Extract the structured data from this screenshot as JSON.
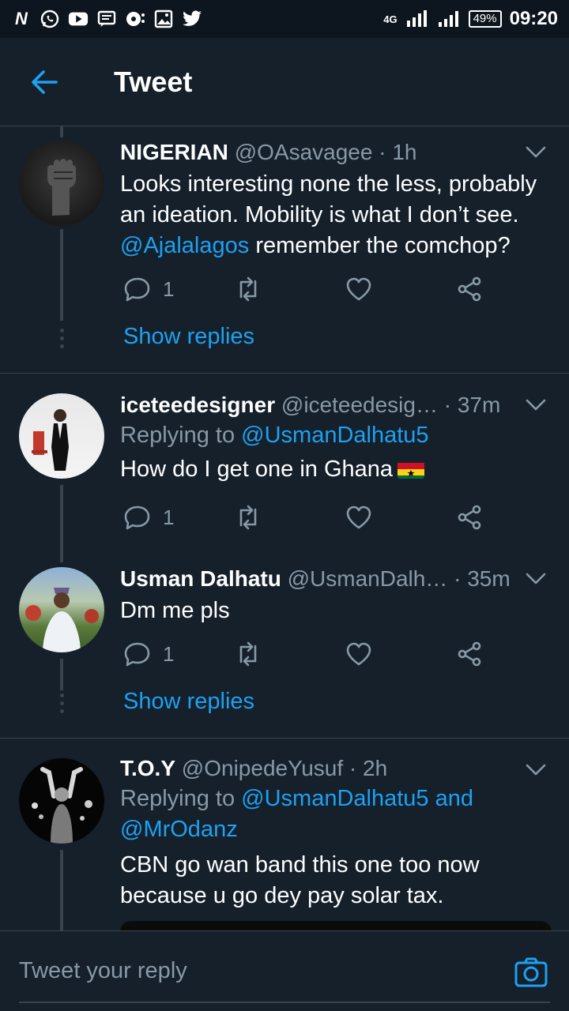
{
  "status_bar": {
    "left_icons": [
      "n-app-icon",
      "whatsapp-icon",
      "youtube-icon",
      "message-icon",
      "tv-icon",
      "gallery-icon",
      "twitter-icon"
    ],
    "network": "4G",
    "battery": "49%",
    "time": "09:20"
  },
  "header": {
    "title": "Tweet"
  },
  "tweets": [
    {
      "name": "NIGERIAN",
      "handle": "@OAsavagee",
      "time": "· 1h",
      "text": "Looks interesting none the less, probably an ideation. Mobility is what I don’t see.",
      "mention": "@Ajalalagos",
      "text_after": " remember the comchop?",
      "replies": "1",
      "show_replies": "Show replies"
    },
    {
      "name": "iceteedesigner",
      "handle": "@iceteedesig…",
      "time": "· 37m",
      "replying_prefix": "Replying to ",
      "replying_to": "@UsmanDalhatu5",
      "text": "How do I get one in Ghana",
      "replies": "1"
    },
    {
      "name": "Usman Dalhatu",
      "handle": "@UsmanDalh…",
      "time": "· 35m",
      "text": "Dm me pls",
      "replies": "1",
      "show_replies": "Show replies"
    },
    {
      "name": "T.O.Y",
      "handle": "@OnipedeYusuf",
      "time": "· 2h",
      "replying_prefix": "Replying to ",
      "replying_to": "@UsmanDalhatu5 and @MrOdanz",
      "text": "CBN go wan band this one too now because u go dey pay solar tax."
    }
  ],
  "composer": {
    "placeholder": "Tweet your reply"
  },
  "colors": {
    "background": "#15202b",
    "accent": "#1da1f2",
    "muted": "#8899a6",
    "divider": "#38444d"
  }
}
